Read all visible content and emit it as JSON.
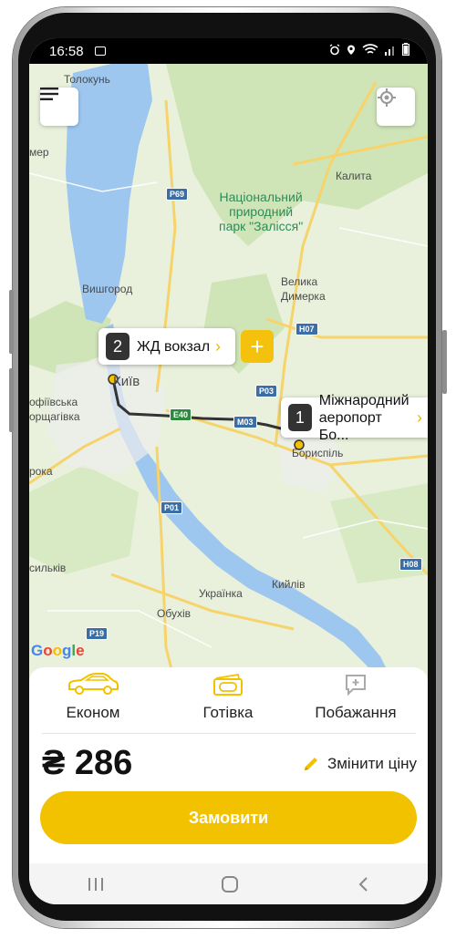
{
  "status": {
    "time": "16:58"
  },
  "map": {
    "labels": {
      "tolokun": "Толокунь",
      "mer": "мер",
      "vyshhorod": "Вишгород",
      "kyiv": "Київ",
      "sofiivska": "офіївська",
      "borshchahivka": "орщагівка",
      "roka": "рока",
      "brovary": "",
      "kalyta": "Калита",
      "velyka": "Велика",
      "dymerka": "Димерка",
      "boryspil": "Бориспіль",
      "ukrainka": "Українка",
      "obukhiv": "Обухів",
      "kyiliv": "Кийлів",
      "vasylkiv": "сильків"
    },
    "park_name_line1": "Національний",
    "park_name_line2": "природний",
    "park_name_line3": "парк \"Залісся\"",
    "roads": {
      "p69": "P69",
      "h07": "H07",
      "p03": "P03",
      "e40": "E40",
      "m03": "M03",
      "p01": "P01",
      "h08": "H08",
      "p19": "P19"
    },
    "stop2": {
      "number": "2",
      "label": "ЖД вокзал"
    },
    "stop1": {
      "number": "1",
      "label_line1": "Міжнародний",
      "label_line2": "аеропорт Бо..."
    },
    "google": "Google"
  },
  "options": [
    {
      "label": "Економ",
      "icon": "car-icon"
    },
    {
      "label": "Готівка",
      "icon": "cash-icon"
    },
    {
      "label": "Побажання",
      "icon": "wishes-icon"
    }
  ],
  "price": "₴ 286",
  "change_price": "Змінити ціну",
  "order_button": "Замовити",
  "colors": {
    "accent": "#f2c100",
    "route": "#333333"
  }
}
